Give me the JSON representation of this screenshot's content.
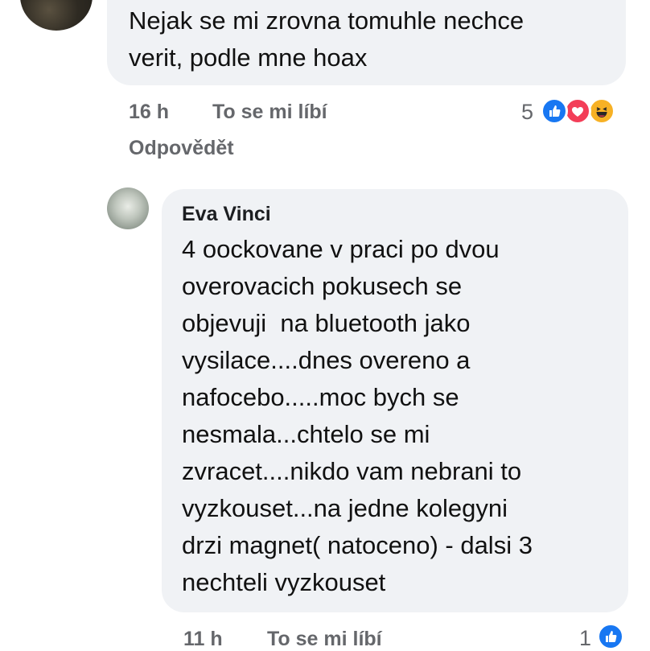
{
  "comment1": {
    "text": "Nejak se mi zrovna tomuhle nechce\nverit, podle mne hoax",
    "time": "16 h",
    "like_label": "To se mi líbí",
    "reply_label": "Odpovědět",
    "reaction_count": "5",
    "reactions": [
      "like-icon",
      "love-icon",
      "haha-icon"
    ]
  },
  "comment2": {
    "author": "Eva Vinci",
    "text": "4 oockovane v praci po dvou\noverovacich pokusech se\nobjevuji  na bluetooth jako\nvysilace....dnes overeno a\nnafocebo.....moc bych se\nnesmala...chtelo se mi\nzvracet....nikdo vam nebrani to\nvyzkouset...na jedne kolegyni\ndrzi magnet( natoceno) - dalsi 3\nnechteli vyzkouset",
    "time": "11 h",
    "like_label": "To se mi líbí",
    "reaction_count": "1",
    "reactions": [
      "like-icon"
    ]
  },
  "colors": {
    "bubble": "#f0f2f5",
    "meta_text": "#65676b",
    "like_blue": "#1877f2",
    "love_red": "#f33e58",
    "haha_yellow": "#f7b125"
  }
}
